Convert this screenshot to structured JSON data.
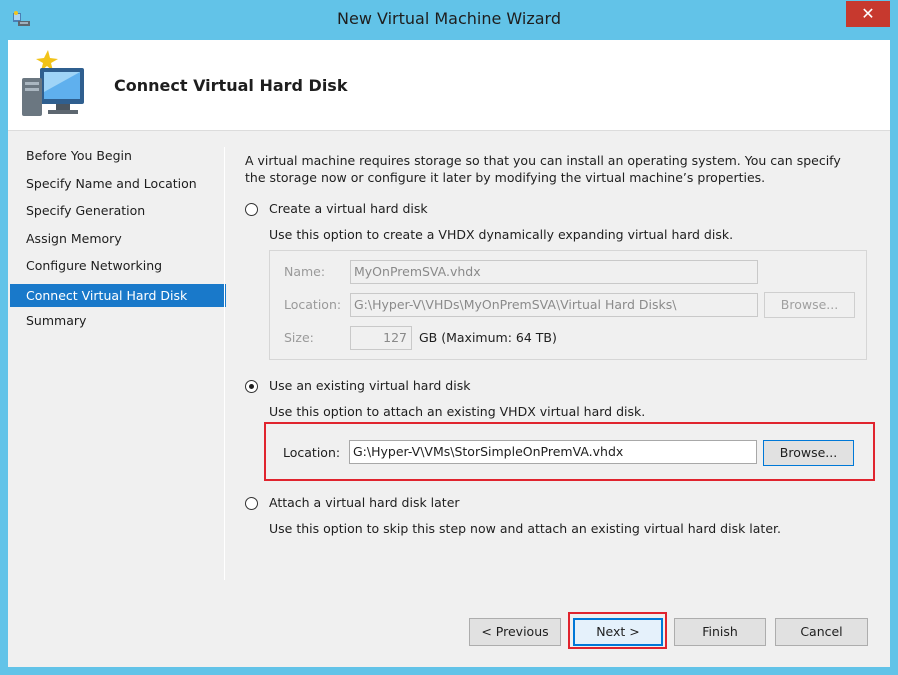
{
  "window": {
    "title": "New Virtual Machine Wizard",
    "close_glyph": "✕"
  },
  "header": {
    "page_title": "Connect Virtual Hard Disk"
  },
  "nav": {
    "items": [
      {
        "label": "Before You Begin",
        "selected": false
      },
      {
        "label": "Specify Name and Location",
        "selected": false
      },
      {
        "label": "Specify Generation",
        "selected": false
      },
      {
        "label": "Assign Memory",
        "selected": false
      },
      {
        "label": "Configure Networking",
        "selected": false
      },
      {
        "label": "Connect Virtual Hard Disk",
        "selected": true
      },
      {
        "label": "Summary",
        "selected": false
      }
    ]
  },
  "main": {
    "intro": "A virtual machine requires storage so that you can install an operating system. You can specify the storage now or configure it later by modifying the virtual machine’s properties.",
    "options": {
      "create": {
        "label": "Create a virtual hard disk",
        "desc": "Use this option to create a VHDX dynamically expanding virtual hard disk.",
        "checked": false,
        "name_label": "Name:",
        "name_value": "MyOnPremSVA.vhdx",
        "location_label": "Location:",
        "location_value": "G:\\Hyper-V\\VHDs\\MyOnPremSVA\\Virtual Hard Disks\\",
        "browse_label": "Browse...",
        "size_label": "Size:",
        "size_value": "127",
        "size_unit": "GB (Maximum: 64 TB)"
      },
      "existing": {
        "label": "Use an existing virtual hard disk",
        "desc": "Use this option to attach an existing VHDX virtual hard disk.",
        "checked": true,
        "location_label": "Location:",
        "location_value": "G:\\Hyper-V\\VMs\\StorSimpleOnPremVA.vhdx",
        "browse_label": "Browse..."
      },
      "later": {
        "label": "Attach a virtual hard disk later",
        "desc": "Use this option to skip this step now and attach an existing virtual hard disk later.",
        "checked": false
      }
    }
  },
  "footer": {
    "previous": "< Previous",
    "next": "Next >",
    "finish": "Finish",
    "cancel": "Cancel"
  },
  "colors": {
    "titlebar": "#62c3e8",
    "selection": "#1979ca",
    "highlight": "#e0242e",
    "close": "#c7392e"
  }
}
